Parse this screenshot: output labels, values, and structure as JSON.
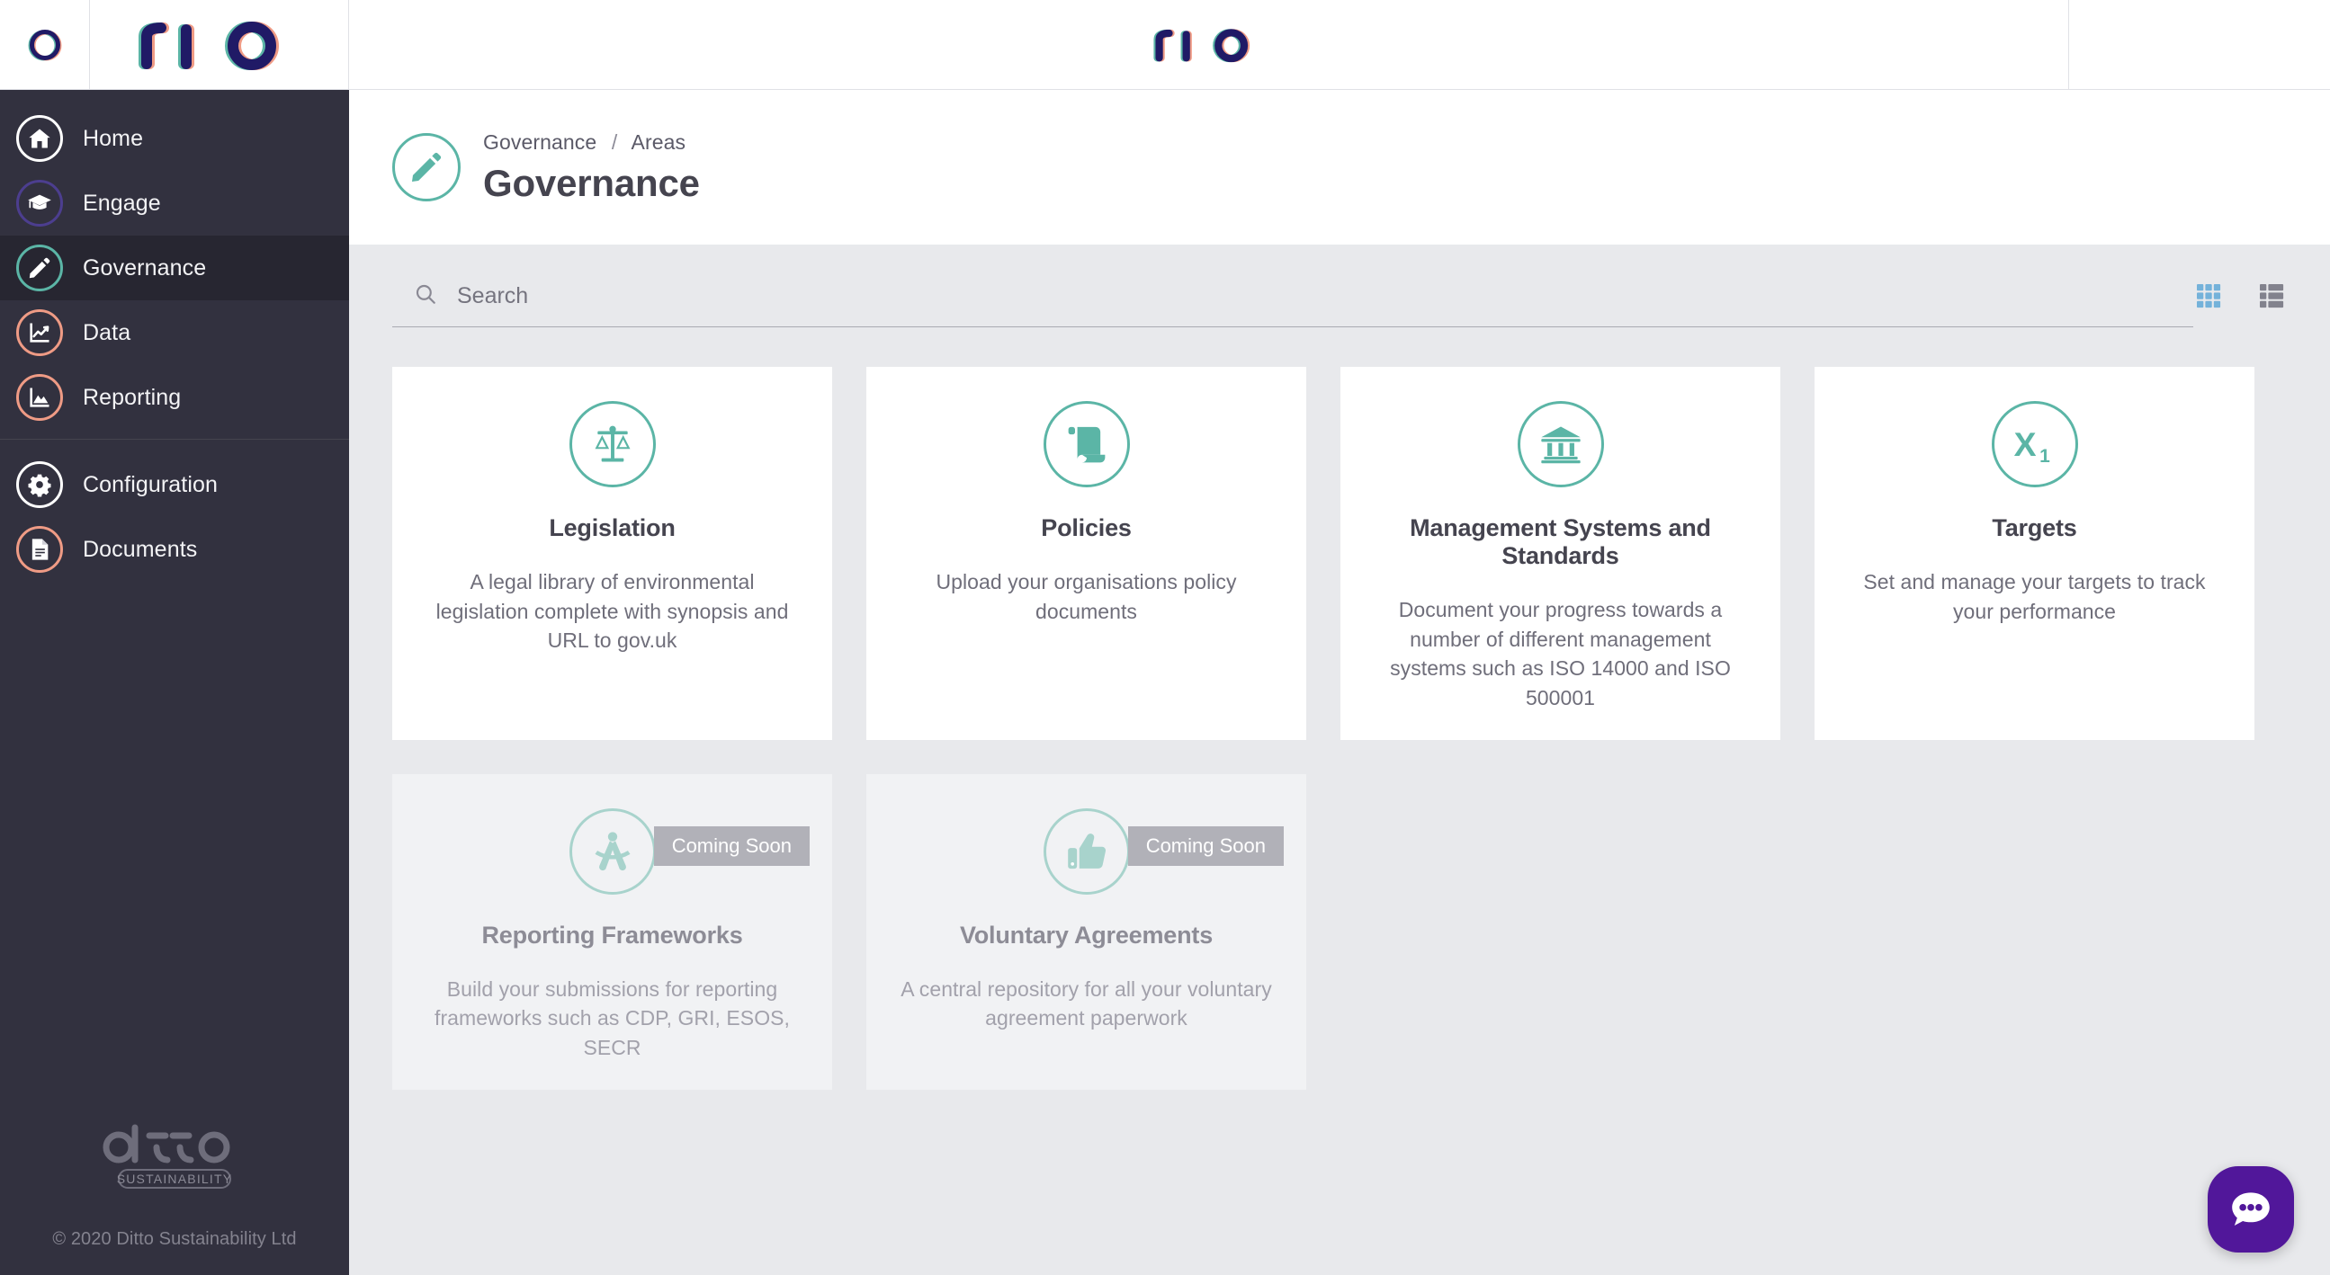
{
  "brand": {
    "mark": "rio-circle-logo",
    "wordmark": "rio",
    "center_wordmark": "rio"
  },
  "sidebar": {
    "primary_items": [
      {
        "label": "Home",
        "icon": "home-icon",
        "ring": "#ffffff",
        "active": false
      },
      {
        "label": "Engage",
        "icon": "graduation-cap-icon",
        "ring": "#4c3e8f",
        "active": false
      },
      {
        "label": "Governance",
        "icon": "pencil-icon",
        "ring": "#5bb5a6",
        "active": true
      },
      {
        "label": "Data",
        "icon": "line-chart-icon",
        "ring": "#ef9b85",
        "active": false
      },
      {
        "label": "Reporting",
        "icon": "area-chart-icon",
        "ring": "#ef9b85",
        "active": false
      }
    ],
    "secondary_items": [
      {
        "label": "Configuration",
        "icon": "gear-icon",
        "ring": "#ffffff",
        "active": false
      },
      {
        "label": "Documents",
        "icon": "document-icon",
        "ring": "#ef9b85",
        "active": false
      }
    ],
    "footer": {
      "logo_word": "ditto",
      "logo_sub": "SUSTAINABILITY",
      "copyright": "© 2020 Ditto Sustainability Ltd"
    }
  },
  "page": {
    "icon": "pencil-icon",
    "breadcrumb": {
      "parent": "Governance",
      "separator": "/",
      "current": "Areas"
    },
    "title": "Governance"
  },
  "search": {
    "placeholder": "Search",
    "value": "",
    "icon": "search-icon"
  },
  "view_toggles": [
    {
      "name": "grid-view",
      "label": "Grid view",
      "active": true,
      "color": "#74b2da"
    },
    {
      "name": "list-view",
      "label": "List view",
      "active": false,
      "color": "#82828d"
    }
  ],
  "cards": [
    {
      "title": "Legislation",
      "description": "A legal library of environmental legislation complete with synopsis and URL to gov.uk",
      "icon": "scales-of-justice-icon",
      "coming_soon": false,
      "badge": ""
    },
    {
      "title": "Policies",
      "description": "Upload your organisations policy documents",
      "icon": "scroll-icon",
      "coming_soon": false,
      "badge": ""
    },
    {
      "title": "Management Systems and Standards",
      "description": "Document your progress towards a number of different management systems such as ISO 14000 and ISO 500001",
      "icon": "bank-building-icon",
      "coming_soon": false,
      "badge": ""
    },
    {
      "title": "Targets",
      "description": "Set and manage your targets to track your performance",
      "icon": "x-subscript-one-icon",
      "coming_soon": false,
      "badge": ""
    },
    {
      "title": "Reporting Frameworks",
      "description": "Build your submissions for reporting frameworks such as CDP, GRI, ESOS, SECR",
      "icon": "compass-divider-icon",
      "coming_soon": true,
      "badge": "Coming Soon"
    },
    {
      "title": "Voluntary Agreements",
      "description": "A central repository for all your voluntary agreement paperwork",
      "icon": "thumbs-up-icon",
      "coming_soon": true,
      "badge": "Coming Soon"
    }
  ],
  "chat": {
    "name": "chat-widget",
    "icon": "speech-bubble-icon",
    "color": "#51179a"
  },
  "colors": {
    "sidebar_bg": "#32313f",
    "sidebar_active_bg": "#272631",
    "content_bg": "#e8e9ec",
    "accent_teal": "#5bb5a6",
    "accent_navy": "#201a66",
    "accent_salmon": "#ef9b85",
    "accent_purple": "#4c3e8f"
  }
}
